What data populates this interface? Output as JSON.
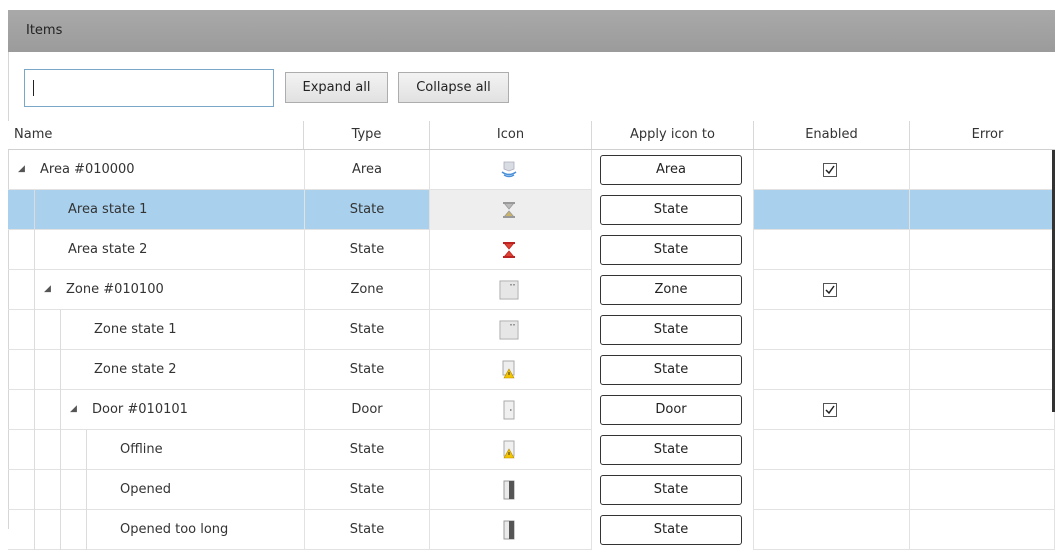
{
  "panel": {
    "title": "Items"
  },
  "search": {
    "value": "",
    "placeholder": ""
  },
  "toolbar": {
    "expand_all": "Expand all",
    "collapse_all": "Collapse all"
  },
  "columns": {
    "name": "Name",
    "type": "Type",
    "icon": "Icon",
    "apply": "Apply icon to",
    "enabled": "Enabled",
    "error": "Error"
  },
  "rows": [
    {
      "name": "Area #010000",
      "type": "Area",
      "apply": "Area",
      "icon": "area-icon",
      "enabled": true,
      "expanded": true
    },
    {
      "name": "Area state 1",
      "type": "State",
      "apply": "State",
      "icon": "area-state-ok-icon",
      "selected": true
    },
    {
      "name": "Area state 2",
      "type": "State",
      "apply": "State",
      "icon": "area-state-alarm-icon"
    },
    {
      "name": "Zone #010100",
      "type": "Zone",
      "apply": "Zone",
      "icon": "zone-icon",
      "enabled": true,
      "expanded": true
    },
    {
      "name": "Zone state 1",
      "type": "State",
      "apply": "State",
      "icon": "zone-icon"
    },
    {
      "name": "Zone state 2",
      "type": "State",
      "apply": "State",
      "icon": "zone-warning-icon"
    },
    {
      "name": "Door #010101",
      "type": "Door",
      "apply": "Door",
      "icon": "door-icon",
      "enabled": true,
      "expanded": true
    },
    {
      "name": "Offline",
      "type": "State",
      "apply": "State",
      "icon": "door-warning-icon"
    },
    {
      "name": "Opened",
      "type": "State",
      "apply": "State",
      "icon": "door-open-icon"
    },
    {
      "name": "Opened too long",
      "type": "State",
      "apply": "State",
      "icon": "door-open-icon"
    }
  ],
  "colors": {
    "selected_row": "#a9d1ee",
    "header_bar": "#a3a3a3",
    "search_border": "#7aa7c7"
  }
}
